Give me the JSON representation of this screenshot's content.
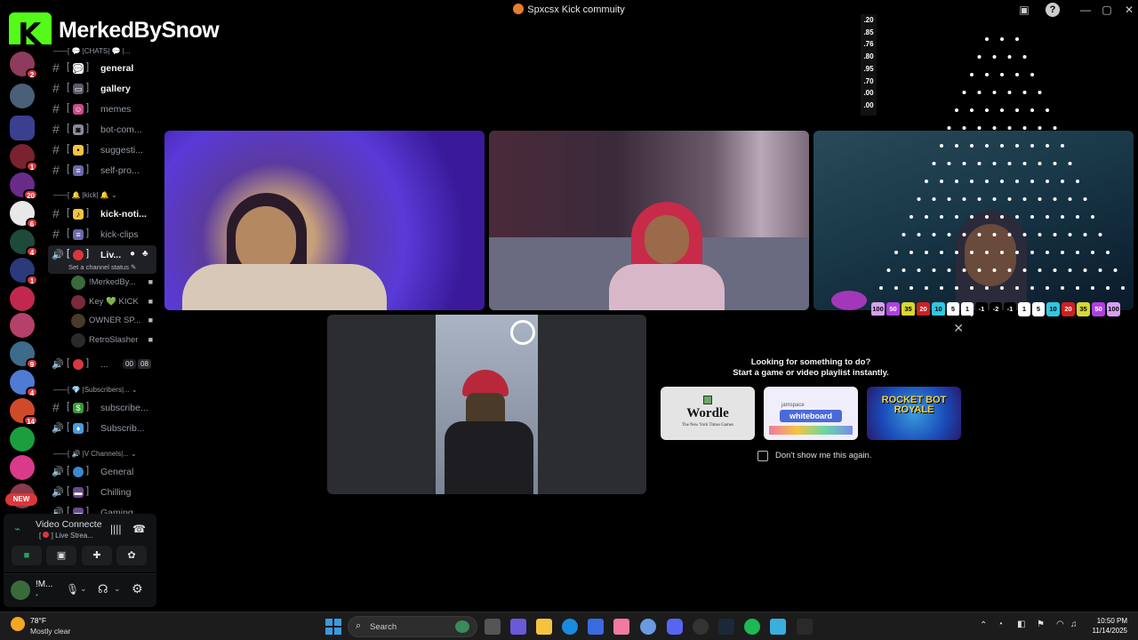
{
  "window": {
    "title": "Spxcsx Kick commuity"
  },
  "overlay": {
    "brand": "MerkedBySnow"
  },
  "servers": [
    {
      "name": "server-1",
      "badge": "2",
      "color": "#8e3b5e"
    },
    {
      "name": "server-2",
      "badge": "",
      "color": "#4a6078"
    },
    {
      "name": "folder",
      "badge": "",
      "color": "#3b3f8f"
    },
    {
      "name": "server-4",
      "badge": "1",
      "color": "#7a2230"
    },
    {
      "name": "server-5",
      "badge": "20",
      "color": "#6a2a8a"
    },
    {
      "name": "server-6",
      "badge": "6",
      "color": "#e8e8e8"
    },
    {
      "name": "server-7",
      "badge": "4",
      "color": "#1d4a3a"
    },
    {
      "name": "server-8",
      "badge": "1",
      "color": "#2a3a7a"
    },
    {
      "name": "server-9",
      "badge": "",
      "color": "#c0284e"
    },
    {
      "name": "server-10",
      "badge": "",
      "color": "#b5406a"
    },
    {
      "name": "server-11",
      "badge": "9",
      "color": "#3d6b8a"
    },
    {
      "name": "server-12",
      "badge": "4",
      "color": "#4f7bd3"
    },
    {
      "name": "server-13",
      "badge": "14",
      "color": "#d04a2a"
    },
    {
      "name": "server-14",
      "badge": "",
      "color": "#1a9e3e"
    },
    {
      "name": "server-15",
      "badge": "",
      "color": "#d93a8a"
    },
    {
      "name": "server-16",
      "badge": "",
      "color": "#8a3a4a"
    }
  ],
  "new_badge": "NEW",
  "channels": {
    "cat_chats": "💬 |CHATS| 💬 |...",
    "general": "general",
    "gallery": "gallery",
    "memes": "memes",
    "bot_commands": "bot-com...",
    "suggestions": "suggesti...",
    "self_promo": "self-pro...",
    "cat_kick": "🔔 |kick| 🔔",
    "kick_notifications": "kick-noti...",
    "kick_clips": "kick-clips",
    "live_channel": "Liv...",
    "channel_status": "Set a channel status",
    "voice_users": [
      {
        "name": "!MerkedBy...",
        "color": "#3a6a3a"
      },
      {
        "name": "Key",
        "extra": "💚 KICK",
        "color": "#7a2a3a"
      },
      {
        "name": "OWNER SP...",
        "color": "#4a3a2a"
      },
      {
        "name": "RetroSlasher",
        "color": "#2a2a2a"
      }
    ],
    "live2_label": "...",
    "live2_time": "00",
    "live2_count": "08",
    "cat_subscribers": "💎 |Subscribers|...",
    "subscriber1": "subscribe...",
    "subscriber2": "Subscrib...",
    "cat_vchannels": "🔊 |V Channels|...",
    "v_general": "General",
    "v_chilling": "Chilling",
    "v_gaming": "Gaming"
  },
  "voice_panel": {
    "status": "Video Connecte",
    "channel": "Live Strea..."
  },
  "user_panel": {
    "username": "!M...",
    "status": "•"
  },
  "overlay_numbers": [
    ".20",
    ".85",
    ".76",
    ".80",
    ".95",
    ".70",
    ".00",
    ".00"
  ],
  "scores": [
    "100",
    "50",
    "35",
    "20",
    "10",
    "5",
    "1",
    "-1",
    "-2",
    "-1",
    "1",
    "5",
    "10",
    "20",
    "35",
    "50",
    "100"
  ],
  "activity": {
    "line1": "Looking for something to do?",
    "line2": "Start a game or video playlist instantly.",
    "cards": [
      {
        "name": "Wordle",
        "sub": "The New York Times Games"
      },
      {
        "name": "whiteboard",
        "sub": "jamspace"
      },
      {
        "name": "ROCKET BOT ROYALE",
        "sub": ""
      }
    ],
    "checkbox_label": "Don't show me this again."
  },
  "taskbar": {
    "weather_temp": "78°F",
    "weather_desc": "Mostly clear",
    "search_label": "Search",
    "time": "10:50 PM",
    "date": "11/14/2025"
  },
  "colors": {
    "kick_green": "#53fc18",
    "discord_red": "#da373c",
    "background": "#000000"
  }
}
